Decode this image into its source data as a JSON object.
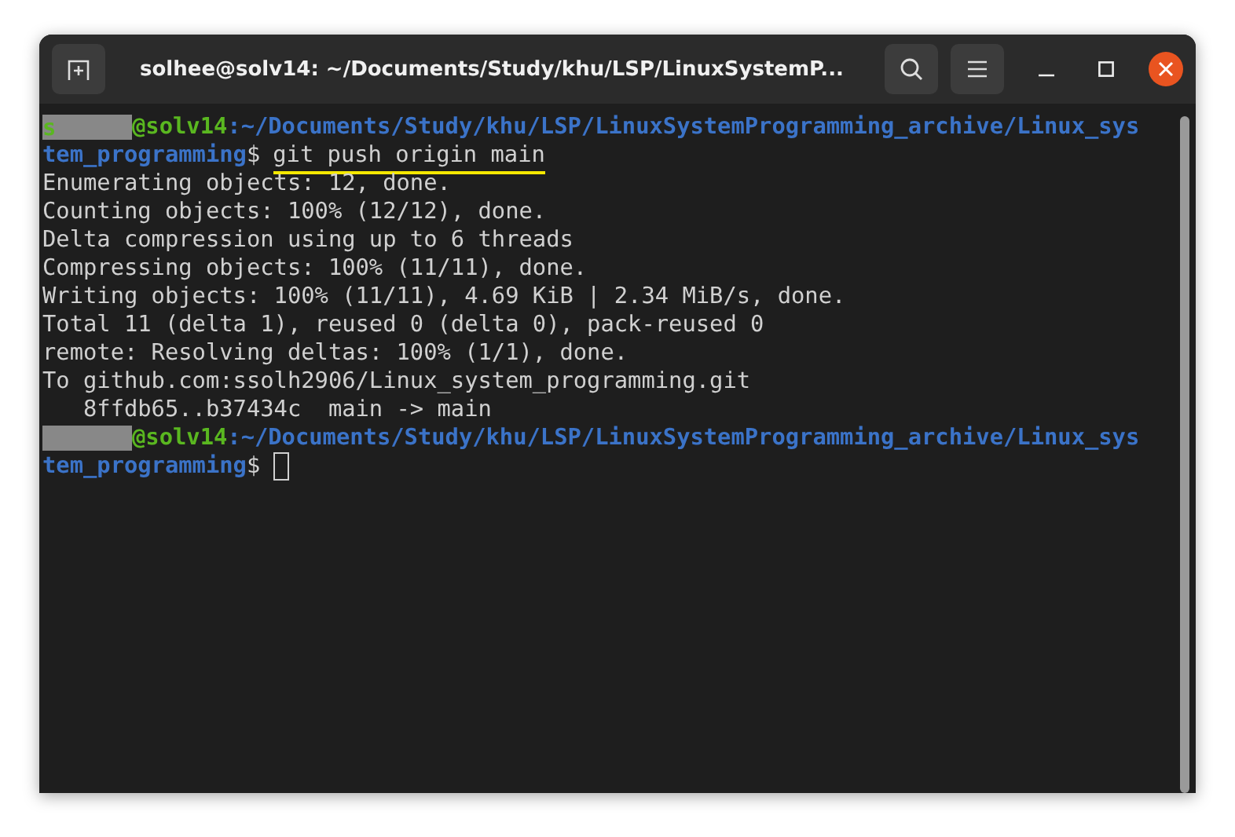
{
  "window": {
    "title": "solhee@solv14: ~/Documents/Study/khu/LSP/LinuxSystemP..."
  },
  "terminal": {
    "lines": [
      {
        "kind": "prompt",
        "user": "s",
        "host": "@solv14",
        "path": ":~/Documents/Study/khu/LSP/LinuxSystemProgramming_archive/Linux_sys",
        "path_rest": "tem_programming",
        "symbol": "$",
        "command": "git push origin main",
        "underlined": true
      },
      {
        "kind": "output",
        "text": "Enumerating objects: 12, done."
      },
      {
        "kind": "output",
        "text": "Counting objects: 100% (12/12), done."
      },
      {
        "kind": "output",
        "text": "Delta compression using up to 6 threads"
      },
      {
        "kind": "output",
        "text": "Compressing objects: 100% (11/11), done."
      },
      {
        "kind": "output",
        "text": "Writing objects: 100% (11/11), 4.69 KiB | 2.34 MiB/s, done."
      },
      {
        "kind": "output",
        "text": "Total 11 (delta 1), reused 0 (delta 0), pack-reused 0"
      },
      {
        "kind": "output",
        "text": "remote: Resolving deltas: 100% (1/1), done."
      },
      {
        "kind": "output",
        "text": "To github.com:ssolh2906/Linux_system_programming.git"
      },
      {
        "kind": "output",
        "text": "   8ffdb65..b37434c  main -> main"
      },
      {
        "kind": "prompt",
        "host": "@solv14",
        "path": ":~/Documents/Study/khu/LSP/LinuxSystemProgramming_archive/Linux_sys",
        "path_rest": "tem_programming",
        "symbol": "$",
        "cursor": true
      }
    ]
  }
}
